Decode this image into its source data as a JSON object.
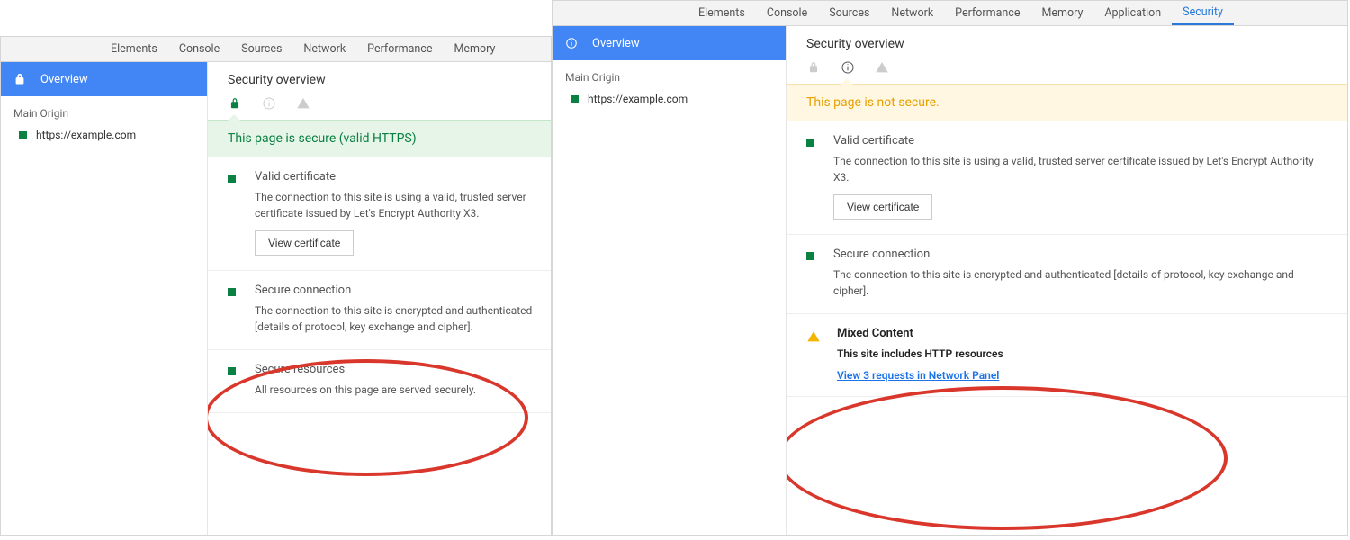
{
  "tabs": {
    "elements": "Elements",
    "console": "Console",
    "sources": "Sources",
    "network": "Network",
    "performance": "Performance",
    "memory": "Memory",
    "application": "Application",
    "security": "Security"
  },
  "sidebar": {
    "overview": "Overview",
    "main_origin": "Main Origin",
    "origin_url": "https://example.com"
  },
  "left": {
    "section_title": "Security overview",
    "banner": "This page is secure (valid HTTPS)",
    "cert": {
      "title": "Valid certificate",
      "desc": "The connection to this site is using a valid, trusted server certificate issued by Let's Encrypt Authority X3.",
      "button": "View certificate"
    },
    "conn": {
      "title": "Secure connection",
      "desc": "The connection to this site is encrypted and authenticated [details of protocol, key exchange and cipher]."
    },
    "res": {
      "title": "Secure resources",
      "desc": "All resources on this page are served securely."
    }
  },
  "right": {
    "section_title": "Security overview",
    "banner": "This page is not secure.",
    "cert": {
      "title": "Valid certificate",
      "desc": "The connection to this site is using a valid, trusted server certificate issued by Let's Encrypt Authority X3.",
      "button": "View certificate"
    },
    "conn": {
      "title": "Secure connection",
      "desc": "The connection to this site is encrypted and authenticated [details of protocol, key exchange and cipher]."
    },
    "mixed": {
      "title": "Mixed Content",
      "desc": "This site includes HTTP resources",
      "link": "View 3 requests in Network Panel"
    }
  }
}
